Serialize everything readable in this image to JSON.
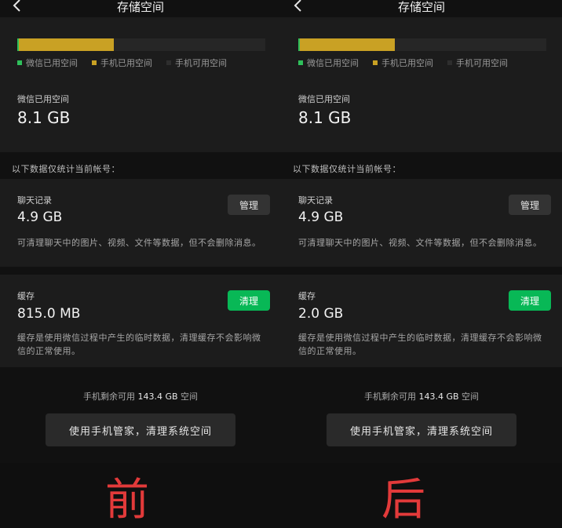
{
  "panels": [
    {
      "title": "存储空间",
      "legend": {
        "wechat": "微信已用空间",
        "phone_used": "手机已用空间",
        "phone_free": "手机可用空间"
      },
      "storage_bar": {
        "wechat_fraction": 0.005,
        "phone_used_fraction": 0.385
      },
      "wechat_used": {
        "label": "微信已用空间",
        "value": "8.1 GB"
      },
      "section_note": "以下数据仅统计当前帐号：",
      "chat": {
        "label": "聊天记录",
        "size": "4.9 GB",
        "button": "管理",
        "desc": "可清理聊天中的图片、视频、文件等数据，但不会删除消息。"
      },
      "cache": {
        "label": "缓存",
        "size": "815.0 MB",
        "button": "清理",
        "desc": "缓存是使用微信过程中产生的临时数据，清理缓存不会影响微信的正常使用。"
      },
      "remaining": {
        "prefix": "手机剩余可用",
        "value": "143.4 GB",
        "suffix": "空间"
      },
      "manager_button": "使用手机管家，清理系统空间"
    },
    {
      "title": "存储空间",
      "legend": {
        "wechat": "微信已用空间",
        "phone_used": "手机已用空间",
        "phone_free": "手机可用空间"
      },
      "storage_bar": {
        "wechat_fraction": 0.005,
        "phone_used_fraction": 0.385
      },
      "wechat_used": {
        "label": "微信已用空间",
        "value": "8.1 GB"
      },
      "section_note": "以下数据仅统计当前帐号：",
      "chat": {
        "label": "聊天记录",
        "size": "4.9 GB",
        "button": "管理",
        "desc": "可清理聊天中的图片、视频、文件等数据，但不会删除消息。"
      },
      "cache": {
        "label": "缓存",
        "size": "2.0 GB",
        "button": "清理",
        "desc": "缓存是使用微信过程中产生的临时数据，清理缓存不会影响微信的正常使用。"
      },
      "remaining": {
        "prefix": "手机剩余可用",
        "value": "143.4 GB",
        "suffix": "空间"
      },
      "manager_button": "使用手机管家，清理系统空间"
    }
  ],
  "captions": {
    "before": "前",
    "after": "后"
  },
  "icons": {
    "back": "chevron-left-icon"
  },
  "colors": {
    "wechat": "#2fbf5b",
    "phone_used": "#c9a124",
    "phone_free": "#262626",
    "clean_button": "#08b856",
    "caption": "#e23a3a"
  }
}
